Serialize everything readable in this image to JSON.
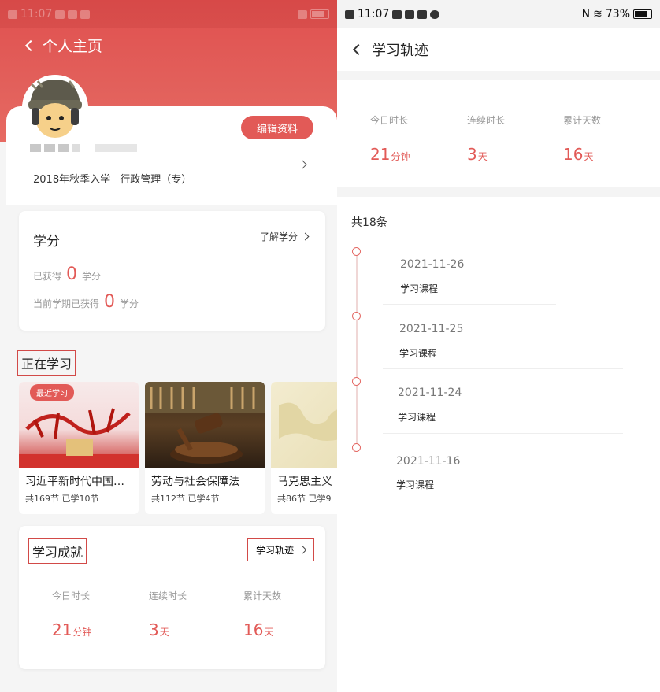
{
  "left": {
    "status_time": "11:07",
    "title": "个人主页",
    "edit_button": "编辑资料",
    "enrollment": "2018年秋季入学",
    "major": "行政管理（专）",
    "credit": {
      "title": "学分",
      "link": "了解学分",
      "earned_label": "已获得",
      "earned_value": "0",
      "unit": "学分",
      "term_label": "当前学期已获得",
      "term_value": "0"
    },
    "studying": {
      "title": "正在学习",
      "recent_tag": "最近学习",
      "courses": [
        {
          "name": "习近平新时代中国…",
          "meta": "共169节 已学10节"
        },
        {
          "name": "劳动与社会保障法",
          "meta": "共112节 已学4节"
        },
        {
          "name": "马克思主义",
          "meta": "共86节 已学9"
        }
      ]
    },
    "achievement": {
      "title": "学习成就",
      "link": "学习轨迹",
      "stats": [
        {
          "label": "今日时长",
          "value": "21",
          "unit": "分钟"
        },
        {
          "label": "连续时长",
          "value": "3",
          "unit": "天"
        },
        {
          "label": "累计天数",
          "value": "16",
          "unit": "天"
        }
      ]
    }
  },
  "right": {
    "status_time": "11:07",
    "battery": "73%",
    "title": "学习轨迹",
    "stats": [
      {
        "label": "今日时长",
        "value": "21",
        "unit": "分钟"
      },
      {
        "label": "连续时长",
        "value": "3",
        "unit": "天"
      },
      {
        "label": "累计天数",
        "value": "16",
        "unit": "天"
      }
    ],
    "count": "共18条",
    "records": [
      {
        "date": "2021-11-26",
        "type": "学习课程"
      },
      {
        "date": "2021-11-25",
        "type": "学习课程"
      },
      {
        "date": "2021-11-24",
        "type": "学习课程"
      },
      {
        "date": "2021-11-16",
        "type": "学习课程"
      }
    ]
  },
  "colors": {
    "accent": "#e25a57",
    "highlight_box": "#d24a48"
  }
}
